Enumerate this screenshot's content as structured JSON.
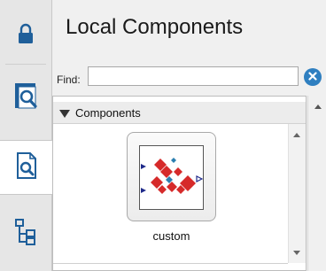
{
  "header": {
    "title": "Local Components"
  },
  "find": {
    "label": "Find:",
    "value": "",
    "placeholder": ""
  },
  "tabs": [
    {
      "icon": "lock-icon",
      "active": false
    },
    {
      "icon": "library-search-icon",
      "active": false
    },
    {
      "icon": "document-search-icon",
      "active": true
    },
    {
      "icon": "hierarchy-tree-icon",
      "active": false
    }
  ],
  "components_section": {
    "label": "Components",
    "items": [
      {
        "label": "custom",
        "icon": "custom-component-icon"
      }
    ]
  },
  "colors": {
    "accent": "#2f7fc0",
    "component_red": "#d62a2a",
    "component_blue": "#2b7fb0",
    "port": "#1f2a8a"
  }
}
